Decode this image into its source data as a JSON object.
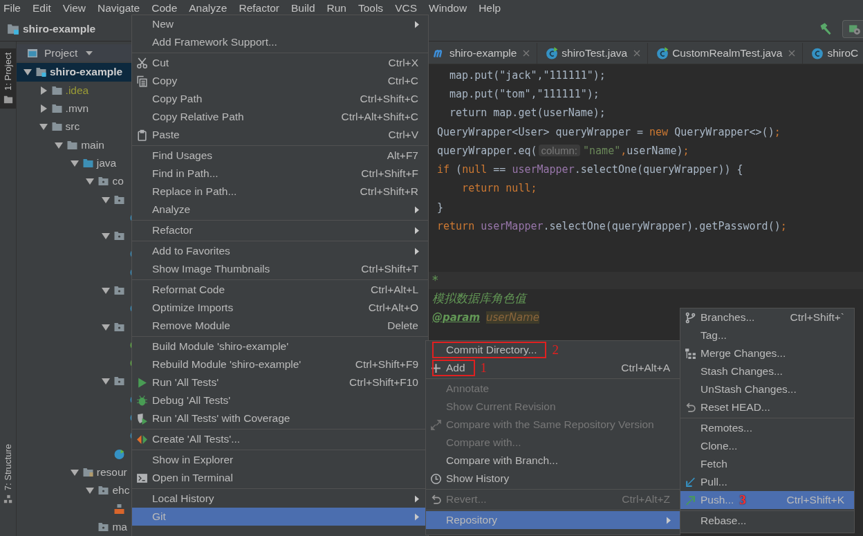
{
  "menu_bar": [
    "File",
    "Edit",
    "View",
    "Navigate",
    "Code",
    "Analyze",
    "Refactor",
    "Build",
    "Run",
    "Tools",
    "VCS",
    "Window",
    "Help"
  ],
  "navigation_bar": {
    "project": "shiro-example"
  },
  "tool_window_stripe": [
    {
      "label": "1: Project",
      "selected": true,
      "kind": "project"
    },
    {
      "label": "7: Structure",
      "selected": false,
      "kind": "structure"
    }
  ],
  "project_panel": {
    "title": "Project",
    "tree": [
      {
        "label": "shiro-example",
        "kind": "module",
        "expanded": true,
        "selected": true,
        "children": [
          {
            "label": ".idea",
            "kind": "folder",
            "expanded": false,
            "selected": false,
            "excluded": true
          },
          {
            "label": ".mvn",
            "kind": "folder",
            "expanded": false,
            "selected": false,
            "excluded": false
          },
          {
            "label": "src",
            "kind": "folder",
            "expanded": true,
            "selected": false,
            "excluded": false,
            "children": [
              {
                "label": "main",
                "kind": "folder",
                "expanded": true,
                "selected": false,
                "children": [
                  {
                    "label": "java",
                    "kind": "source-folder",
                    "expanded": true,
                    "selected": false,
                    "children": [
                      {
                        "label": "co",
                        "kind": "package",
                        "expanded": true,
                        "selected": false,
                        "children": [
                          {
                            "kind": "package",
                            "expanded": true,
                            "selected": false,
                            "children": [
                              {
                                "kind": "class",
                                "selected": false
                              }
                            ]
                          },
                          {
                            "kind": "package",
                            "expanded": true,
                            "selected": false,
                            "children": [
                              {
                                "kind": "class",
                                "selected": false
                              },
                              {
                                "kind": "class",
                                "selected": false
                              }
                            ]
                          },
                          {
                            "kind": "package",
                            "expanded": true,
                            "selected": false,
                            "children": [
                              {
                                "kind": "class",
                                "selected": false
                              }
                            ]
                          },
                          {
                            "kind": "package",
                            "expanded": true,
                            "selected": false,
                            "children": [
                              {
                                "kind": "interface",
                                "selected": false
                              },
                              {
                                "kind": "interface",
                                "selected": false
                              }
                            ]
                          },
                          {
                            "kind": "package",
                            "expanded": true,
                            "selected": false,
                            "children": [
                              {
                                "kind": "class",
                                "selected": false
                              },
                              {
                                "kind": "class",
                                "selected": false
                              },
                              {
                                "kind": "class",
                                "selected": false
                              }
                            ]
                          },
                          {
                            "kind": "app-class",
                            "selected": false
                          }
                        ]
                      }
                    ]
                  },
                  {
                    "label": "resour",
                    "kind": "resources-folder",
                    "expanded": true,
                    "selected": false,
                    "children": [
                      {
                        "label": "ehc",
                        "kind": "package",
                        "expanded": true,
                        "selected": false,
                        "children": [
                          {
                            "kind": "xml",
                            "selected": false
                          }
                        ]
                      },
                      {
                        "label": "ma",
                        "kind": "package",
                        "selected": false
                      }
                    ]
                  }
                ]
              }
            ]
          }
        ]
      }
    ]
  },
  "editor": {
    "tabs": [
      {
        "label": "shiro-example",
        "kind": "maven",
        "closable": true
      },
      {
        "label": "shiroTest.java",
        "kind": "test-class",
        "closable": true
      },
      {
        "label": "CustomRealmTest.java",
        "kind": "test-class",
        "closable": true
      },
      {
        "label": "shiroC",
        "kind": "class",
        "closable": false
      }
    ],
    "code_lines": [
      [
        {
          "kind": "plain",
          "text": "  map.put(\"jack\",\"111111\");"
        }
      ],
      [
        {
          "kind": "plain",
          "text": "  map.put(\"tom\",\"111111\");"
        }
      ],
      [
        {
          "kind": "plain",
          "text": "  return map.get(userName);"
        }
      ],
      [
        {
          "kind": "plain",
          "text": "QueryWrapper<User> queryWrapper = "
        },
        {
          "kind": "keyword",
          "text": "new"
        },
        {
          "kind": "plain",
          "text": " QueryWrapper<>()"
        },
        {
          "kind": "keyword",
          "text": ";"
        }
      ],
      [
        {
          "kind": "plain",
          "text": "queryWrapper.eq("
        },
        {
          "kind": "hint",
          "text": "column:"
        },
        {
          "kind": "string",
          "text": "\"name\""
        },
        {
          "kind": "keyword",
          "text": ","
        },
        {
          "kind": "plain",
          "text": "userName)"
        },
        {
          "kind": "keyword",
          "text": ";"
        }
      ],
      [
        {
          "kind": "keyword",
          "text": "if"
        },
        {
          "kind": "plain",
          "text": " ("
        },
        {
          "kind": "keyword",
          "text": "null"
        },
        {
          "kind": "plain",
          "text": " == "
        },
        {
          "kind": "field",
          "text": "userMapper"
        },
        {
          "kind": "plain",
          "text": ".selectOne(queryWrapper)) {"
        }
      ],
      [
        {
          "kind": "keyword",
          "text": "    return null;"
        }
      ],
      [
        {
          "kind": "plain",
          "text": "}"
        }
      ],
      [
        {
          "kind": "keyword",
          "text": "return "
        },
        {
          "kind": "field",
          "text": "userMapper"
        },
        {
          "kind": "plain",
          "text": ".selectOne(queryWrapper).getPassword()"
        },
        {
          "kind": "keyword",
          "text": ";"
        }
      ]
    ],
    "doc_band": [
      {
        "kind": "doc",
        "text": "*"
      }
    ],
    "doc_lines": [
      [
        {
          "kind": "doc",
          "text": "模拟数据库角色值"
        }
      ],
      [
        {
          "kind": "doc-tag",
          "text": "@param"
        },
        {
          "kind": "doc-param",
          "text": "userName"
        }
      ]
    ]
  },
  "context_menu": {
    "groups": [
      {
        "items": [
          {
            "label": "New",
            "kind": "plain",
            "submenu": true,
            "selected": false
          },
          {
            "label": "Add Framework Support...",
            "kind": "plain",
            "submenu": false,
            "selected": false
          }
        ]
      },
      {
        "items": [
          {
            "label": "Cut",
            "shortcut": "Ctrl+X",
            "kind": "cut",
            "submenu": false,
            "selected": false
          },
          {
            "label": "Copy",
            "shortcut": "Ctrl+C",
            "kind": "copy",
            "submenu": false,
            "selected": false
          },
          {
            "label": "Copy Path",
            "shortcut": "Ctrl+Shift+C",
            "kind": "plain",
            "submenu": false,
            "selected": false
          },
          {
            "label": "Copy Relative Path",
            "shortcut": "Ctrl+Alt+Shift+C",
            "kind": "plain",
            "submenu": false,
            "selected": false
          },
          {
            "label": "Paste",
            "shortcut": "Ctrl+V",
            "kind": "paste",
            "submenu": false,
            "selected": false
          }
        ]
      },
      {
        "items": [
          {
            "label": "Find Usages",
            "shortcut": "Alt+F7",
            "kind": "plain",
            "submenu": false,
            "selected": false
          },
          {
            "label": "Find in Path...",
            "shortcut": "Ctrl+Shift+F",
            "kind": "plain",
            "submenu": false,
            "selected": false
          },
          {
            "label": "Replace in Path...",
            "shortcut": "Ctrl+Shift+R",
            "kind": "plain",
            "submenu": false,
            "selected": false
          },
          {
            "label": "Analyze",
            "kind": "plain",
            "submenu": true,
            "selected": false
          }
        ]
      },
      {
        "items": [
          {
            "label": "Refactor",
            "kind": "plain",
            "submenu": true,
            "selected": false
          }
        ]
      },
      {
        "items": [
          {
            "label": "Add to Favorites",
            "kind": "plain",
            "submenu": true,
            "selected": false
          },
          {
            "label": "Show Image Thumbnails",
            "shortcut": "Ctrl+Shift+T",
            "kind": "plain",
            "submenu": false,
            "selected": false
          }
        ]
      },
      {
        "items": [
          {
            "label": "Reformat Code",
            "shortcut": "Ctrl+Alt+L",
            "kind": "plain",
            "submenu": false,
            "selected": false
          },
          {
            "label": "Optimize Imports",
            "shortcut": "Ctrl+Alt+O",
            "kind": "plain",
            "submenu": false,
            "selected": false
          },
          {
            "label": "Remove Module",
            "shortcut": "Delete",
            "kind": "plain",
            "submenu": false,
            "selected": false
          }
        ]
      },
      {
        "items": [
          {
            "label": "Build Module 'shiro-example'",
            "kind": "plain",
            "submenu": false,
            "selected": false
          },
          {
            "label": "Rebuild Module 'shiro-example'",
            "shortcut": "Ctrl+Shift+F9",
            "kind": "plain",
            "submenu": false,
            "selected": false
          },
          {
            "label": "Run 'All Tests'",
            "shortcut": "Ctrl+Shift+F10",
            "kind": "run",
            "submenu": false,
            "selected": false
          },
          {
            "label": "Debug 'All Tests'",
            "kind": "debug",
            "submenu": false,
            "selected": false
          },
          {
            "label": "Run 'All Tests' with Coverage",
            "kind": "coverage",
            "submenu": false,
            "selected": false
          }
        ]
      },
      {
        "items": [
          {
            "label": "Create 'All Tests'...",
            "kind": "create-test",
            "submenu": false,
            "selected": false
          }
        ]
      },
      {
        "items": [
          {
            "label": "Show in Explorer",
            "kind": "plain",
            "submenu": false,
            "selected": false
          },
          {
            "label": "Open in Terminal",
            "kind": "terminal",
            "submenu": false,
            "selected": false
          }
        ]
      },
      {
        "items": [
          {
            "label": "Local History",
            "kind": "plain",
            "submenu": true,
            "selected": false
          },
          {
            "label": "Git",
            "kind": "plain",
            "submenu": true,
            "selected": true
          }
        ]
      }
    ]
  },
  "git_menu": {
    "groups": [
      {
        "items": [
          {
            "label": "Commit Directory...",
            "kind": "plain",
            "submenu": false,
            "selected": false,
            "disabled": false,
            "boxed": true,
            "note": "2"
          },
          {
            "label": "Add",
            "shortcut": "Ctrl+Alt+A",
            "kind": "add",
            "submenu": false,
            "selected": false,
            "disabled": false,
            "boxed": true,
            "note": "1"
          }
        ]
      },
      {
        "items": [
          {
            "label": "Annotate",
            "kind": "plain",
            "submenu": false,
            "selected": false,
            "disabled": true,
            "boxed": false
          },
          {
            "label": "Show Current Revision",
            "kind": "plain",
            "submenu": false,
            "selected": false,
            "disabled": true,
            "boxed": false
          },
          {
            "label": "Compare with the Same Repository Version",
            "kind": "compare",
            "submenu": false,
            "selected": false,
            "disabled": true,
            "boxed": false
          },
          {
            "label": "Compare with...",
            "kind": "plain",
            "submenu": false,
            "selected": false,
            "disabled": true,
            "boxed": false
          },
          {
            "label": "Compare with Branch...",
            "kind": "plain",
            "submenu": false,
            "selected": false,
            "disabled": false,
            "boxed": false
          },
          {
            "label": "Show History",
            "kind": "history",
            "submenu": false,
            "selected": false,
            "disabled": false,
            "boxed": false
          }
        ]
      },
      {
        "items": [
          {
            "label": "Revert...",
            "shortcut": "Ctrl+Alt+Z",
            "kind": "revert",
            "submenu": false,
            "selected": false,
            "disabled": true,
            "boxed": false
          }
        ]
      },
      {
        "items": [
          {
            "label": "Repository",
            "kind": "plain",
            "submenu": true,
            "selected": true,
            "disabled": false,
            "boxed": false
          }
        ]
      }
    ]
  },
  "repository_menu": {
    "groups": [
      {
        "items": [
          {
            "label": "Branches...",
            "shortcut": "Ctrl+Shift+`",
            "kind": "branch",
            "selected": false
          },
          {
            "label": "Tag...",
            "kind": "plain",
            "selected": false
          },
          {
            "label": "Merge Changes...",
            "kind": "merge",
            "selected": false
          },
          {
            "label": "Stash Changes...",
            "kind": "plain",
            "selected": false
          },
          {
            "label": "UnStash Changes...",
            "kind": "plain",
            "selected": false
          },
          {
            "label": "Reset HEAD...",
            "kind": "revert",
            "selected": false
          }
        ]
      },
      {
        "items": [
          {
            "label": "Remotes...",
            "kind": "plain",
            "selected": false
          },
          {
            "label": "Clone...",
            "kind": "plain",
            "selected": false
          },
          {
            "label": "Fetch",
            "kind": "plain",
            "selected": false
          },
          {
            "label": "Pull...",
            "kind": "pull",
            "selected": false
          },
          {
            "label": "Push...",
            "shortcut": "Ctrl+Shift+K",
            "kind": "push",
            "selected": true,
            "note": "3"
          }
        ]
      },
      {
        "items": [
          {
            "label": "Rebase...",
            "kind": "plain",
            "selected": false
          }
        ]
      }
    ]
  }
}
